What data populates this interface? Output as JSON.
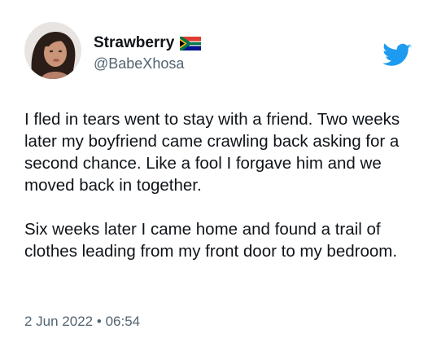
{
  "author": {
    "display_name": "Strawberry",
    "handle": "@BabeXhosa",
    "flag_icon": "south-africa-flag-icon",
    "avatar_icon": "profile-avatar"
  },
  "brand": {
    "icon": "twitter-bird-icon",
    "color": "#1d9bf0"
  },
  "tweet": {
    "paragraphs": [
      "I fled in tears went to stay with a friend. Two weeks later my boyfriend came crawling back asking for a second chance. Like a fool I forgave him and we moved back in together.",
      "Six weeks later I came home and found a trail of clothes leading from my front door to my bedroom."
    ],
    "date": "2 Jun 2022",
    "separator": "•",
    "time": "06:54"
  },
  "colors": {
    "text": "#0f1419",
    "secondary": "#536471",
    "background": "#ffffff"
  }
}
